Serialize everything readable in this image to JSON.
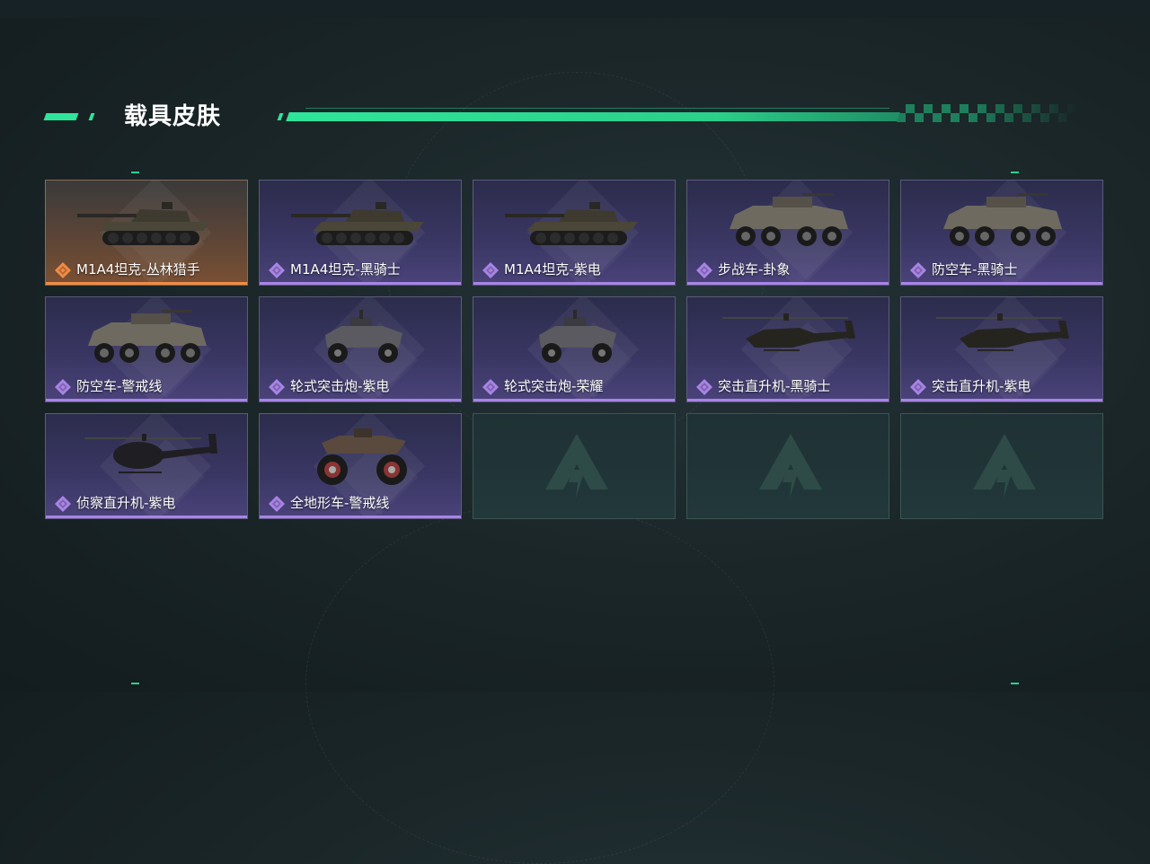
{
  "section": {
    "title": "载具皮肤"
  },
  "colors": {
    "accent": "#2ee59a",
    "rarity_purple": "#a884e6",
    "rarity_orange": "#f08b45"
  },
  "skins": [
    {
      "label": "M1A4坦克-丛林猎手",
      "rarity": "orange",
      "vehicle": "tank",
      "icon": "tank-icon"
    },
    {
      "label": "M1A4坦克-黑骑士",
      "rarity": "purple",
      "vehicle": "tank",
      "icon": "tank-icon"
    },
    {
      "label": "M1A4坦克-紫电",
      "rarity": "purple",
      "vehicle": "tank",
      "icon": "tank-icon"
    },
    {
      "label": "步战车-卦象",
      "rarity": "purple",
      "vehicle": "ifv",
      "icon": "ifv-icon"
    },
    {
      "label": "防空车-黑骑士",
      "rarity": "purple",
      "vehicle": "ifv",
      "icon": "aa-vehicle-icon"
    },
    {
      "label": "防空车-警戒线",
      "rarity": "purple",
      "vehicle": "ifv",
      "icon": "aa-vehicle-icon"
    },
    {
      "label": "轮式突击炮-紫电",
      "rarity": "purple",
      "vehicle": "buggy",
      "icon": "assault-vehicle-icon"
    },
    {
      "label": "轮式突击炮-荣耀",
      "rarity": "purple",
      "vehicle": "buggy",
      "icon": "assault-vehicle-icon"
    },
    {
      "label": "突击直升机-黑骑士",
      "rarity": "purple",
      "vehicle": "heli",
      "icon": "attack-helicopter-icon"
    },
    {
      "label": "突击直升机-紫电",
      "rarity": "purple",
      "vehicle": "heli",
      "icon": "attack-helicopter-icon"
    },
    {
      "label": "侦察直升机-紫电",
      "rarity": "purple",
      "vehicle": "scout",
      "icon": "scout-helicopter-icon"
    },
    {
      "label": "全地形车-警戒线",
      "rarity": "purple",
      "vehicle": "atv",
      "icon": "atv-icon"
    }
  ],
  "empty_slots": 3
}
